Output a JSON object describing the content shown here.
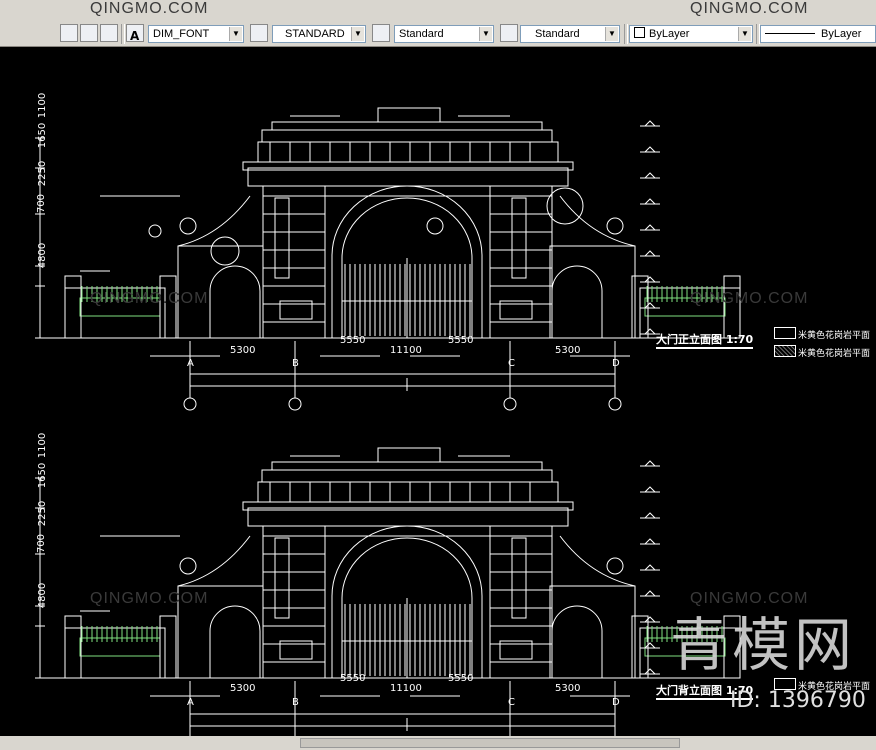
{
  "toolbar": {
    "dim_style": "DIM_FONT",
    "text_style": "STANDARD",
    "table_style": "Standard",
    "multileader_style": "Standard",
    "color": "ByLayer",
    "linetype": "ByLayer"
  },
  "watermarks": {
    "small": "QINGMO.COM",
    "big": "青模网",
    "id": "ID: 1396790"
  },
  "drawing": {
    "front": {
      "title": "大门正立面图 1:70",
      "dims": [
        "5300",
        "5550",
        "5550",
        "5300"
      ],
      "total": "11100",
      "axes": [
        "A",
        "B",
        "C",
        "D"
      ],
      "vertical_dims": [
        "1100",
        "1650",
        "2250",
        "700",
        "4800"
      ]
    },
    "back": {
      "title": "大门背立面图 1:70",
      "dims": [
        "5300",
        "5550",
        "5550",
        "5300"
      ],
      "total": "11100",
      "axes": [
        "A",
        "B",
        "C",
        "D"
      ],
      "vertical_dims": [
        "1100",
        "1650",
        "2250",
        "700",
        "4800"
      ]
    },
    "legend": [
      "米黄色花岗岩平面",
      "米黄色花岗岩平面"
    ]
  },
  "colors": {
    "background": "#000000",
    "line": "#ffffff",
    "fence": "#7fe07f",
    "toolbar": "#d9d6cf"
  }
}
